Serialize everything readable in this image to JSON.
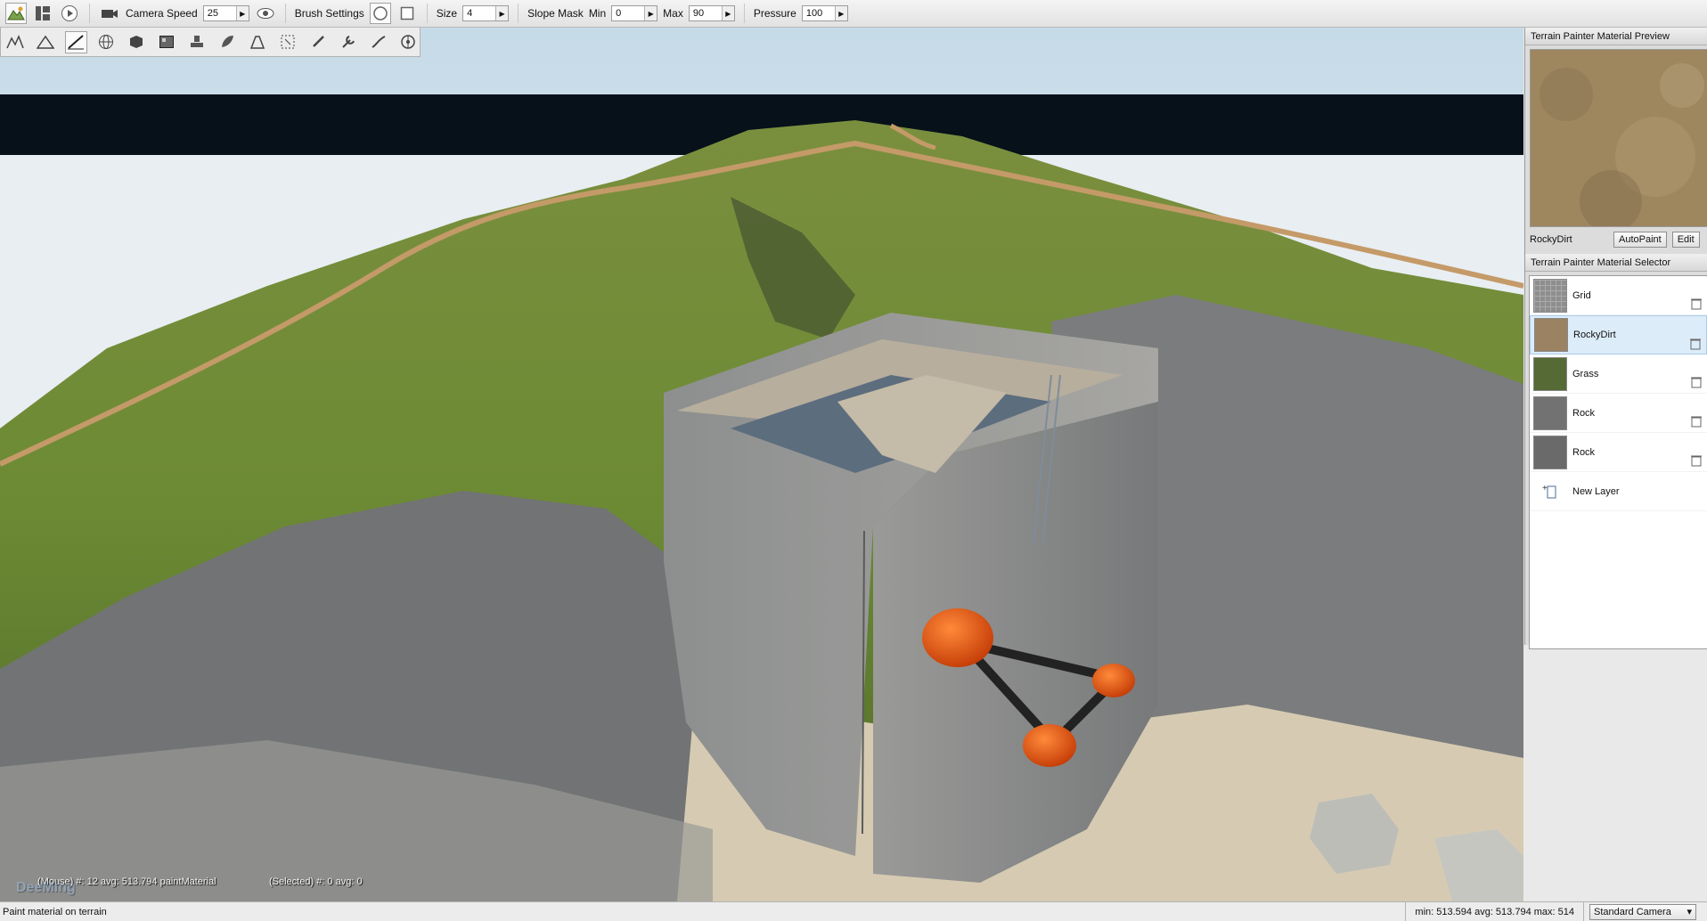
{
  "toolbar": {
    "camera_speed_label": "Camera Speed",
    "camera_speed_value": "25",
    "brush_settings_label": "Brush Settings",
    "size_label": "Size",
    "size_value": "4",
    "slope_mask_label": "Slope Mask",
    "min_label": "Min",
    "min_value": "0",
    "max_label": "Max",
    "max_value": "90",
    "pressure_label": "Pressure",
    "pressure_value": "100"
  },
  "tool_palette": {
    "icons": [
      "raise-terrain-icon",
      "smooth-terrain-icon",
      "paint-material-icon",
      "globe-icon",
      "cube-icon",
      "texture-icon",
      "stamp-icon",
      "leaf-icon",
      "road-icon",
      "select-box-icon",
      "brush-icon",
      "wrench-icon",
      "slope-icon",
      "wheel-icon"
    ],
    "active_index": 2
  },
  "viewport": {
    "hud_mouse": "(Mouse) #: 12  avg: 513.794 paintMaterial",
    "hud_selected": "(Selected) #: 0  avg: 0",
    "watermark": "DeeMing"
  },
  "material_preview": {
    "title": "Terrain Painter Material Preview",
    "material_name": "RockyDirt",
    "autopaint_label": "AutoPaint",
    "edit_label": "Edit"
  },
  "material_selector": {
    "title": "Terrain Painter Material Selector",
    "items": [
      {
        "name": "Grid",
        "color": "#8e8e8e"
      },
      {
        "name": "RockyDirt",
        "color": "#9a8262"
      },
      {
        "name": "Grass",
        "color": "#556a35"
      },
      {
        "name": "Rock",
        "color": "#727272"
      },
      {
        "name": "Rock",
        "color": "#6a6a6a"
      }
    ],
    "new_layer_label": "New Layer"
  },
  "status_bar": {
    "message": "Paint material on terrain",
    "stats": "min: 513.594  avg: 513.794  max: 514",
    "camera": "Standard Camera"
  }
}
